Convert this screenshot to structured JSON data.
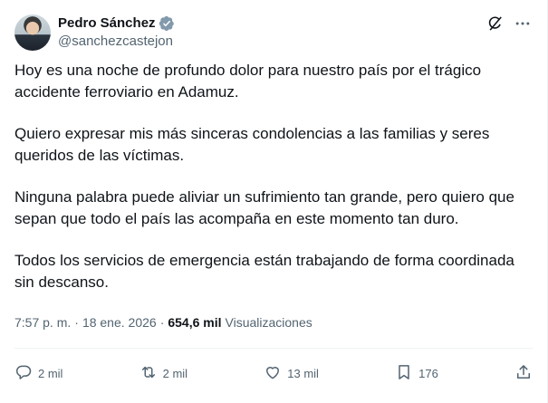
{
  "author": {
    "display_name": "Pedro Sánchez",
    "handle": "@sanchezcastejon",
    "verified": true,
    "verified_color": "#829aab"
  },
  "tweet": {
    "paragraphs": [
      "Hoy es una noche de profundo dolor para nuestro país por el trágico accidente ferroviario en Adamuz.",
      "Quiero expresar mis más sinceras condolencias a las familias y seres queridos de las víctimas.",
      "Ninguna palabra puede aliviar un sufrimiento tan grande, pero quiero que sepan que todo el país las acompaña en este momento tan duro.",
      "Todos los servicios de emergencia están trabajando de forma coordinada sin descanso."
    ]
  },
  "meta": {
    "time": "7:57 p. m.",
    "separator": "·",
    "date": "18 ene. 2026",
    "views_count": "654,6 mil",
    "views_label": "Visualizaciones"
  },
  "actions": {
    "replies": "2 mil",
    "reposts": "2 mil",
    "likes": "13 mil",
    "bookmarks": "176"
  },
  "icons": {
    "grok": "grok-icon",
    "more": "more-icon",
    "reply": "reply-icon",
    "repost": "repost-icon",
    "like": "like-icon",
    "bookmark": "bookmark-icon",
    "share": "share-icon"
  },
  "colors": {
    "text_primary": "#0f1419",
    "text_secondary": "#536471",
    "divider": "#eff3f4"
  }
}
